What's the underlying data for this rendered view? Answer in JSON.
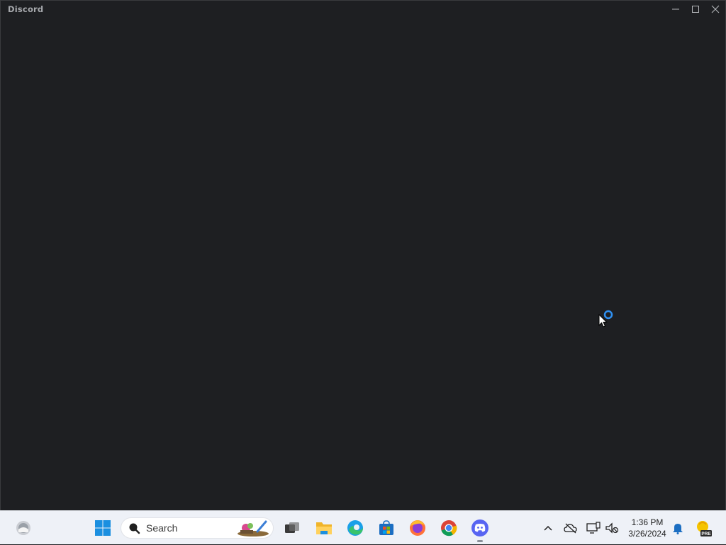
{
  "window": {
    "title": "Discord"
  },
  "taskbar": {
    "search_placeholder": "Search",
    "clock": {
      "time": "1:36 PM",
      "date": "3/26/2024"
    },
    "apps": [
      "widgets-icon",
      "start-icon",
      "task-view-icon",
      "file-explorer-icon",
      "edge-icon",
      "store-icon",
      "firefox-icon",
      "chrome-icon",
      "discord-icon"
    ],
    "badge_label": "PRE"
  },
  "colors": {
    "app_background": "#1e1f22",
    "taskbar_background": "#eef1f7",
    "loading_ring": "#2f8ff0"
  }
}
